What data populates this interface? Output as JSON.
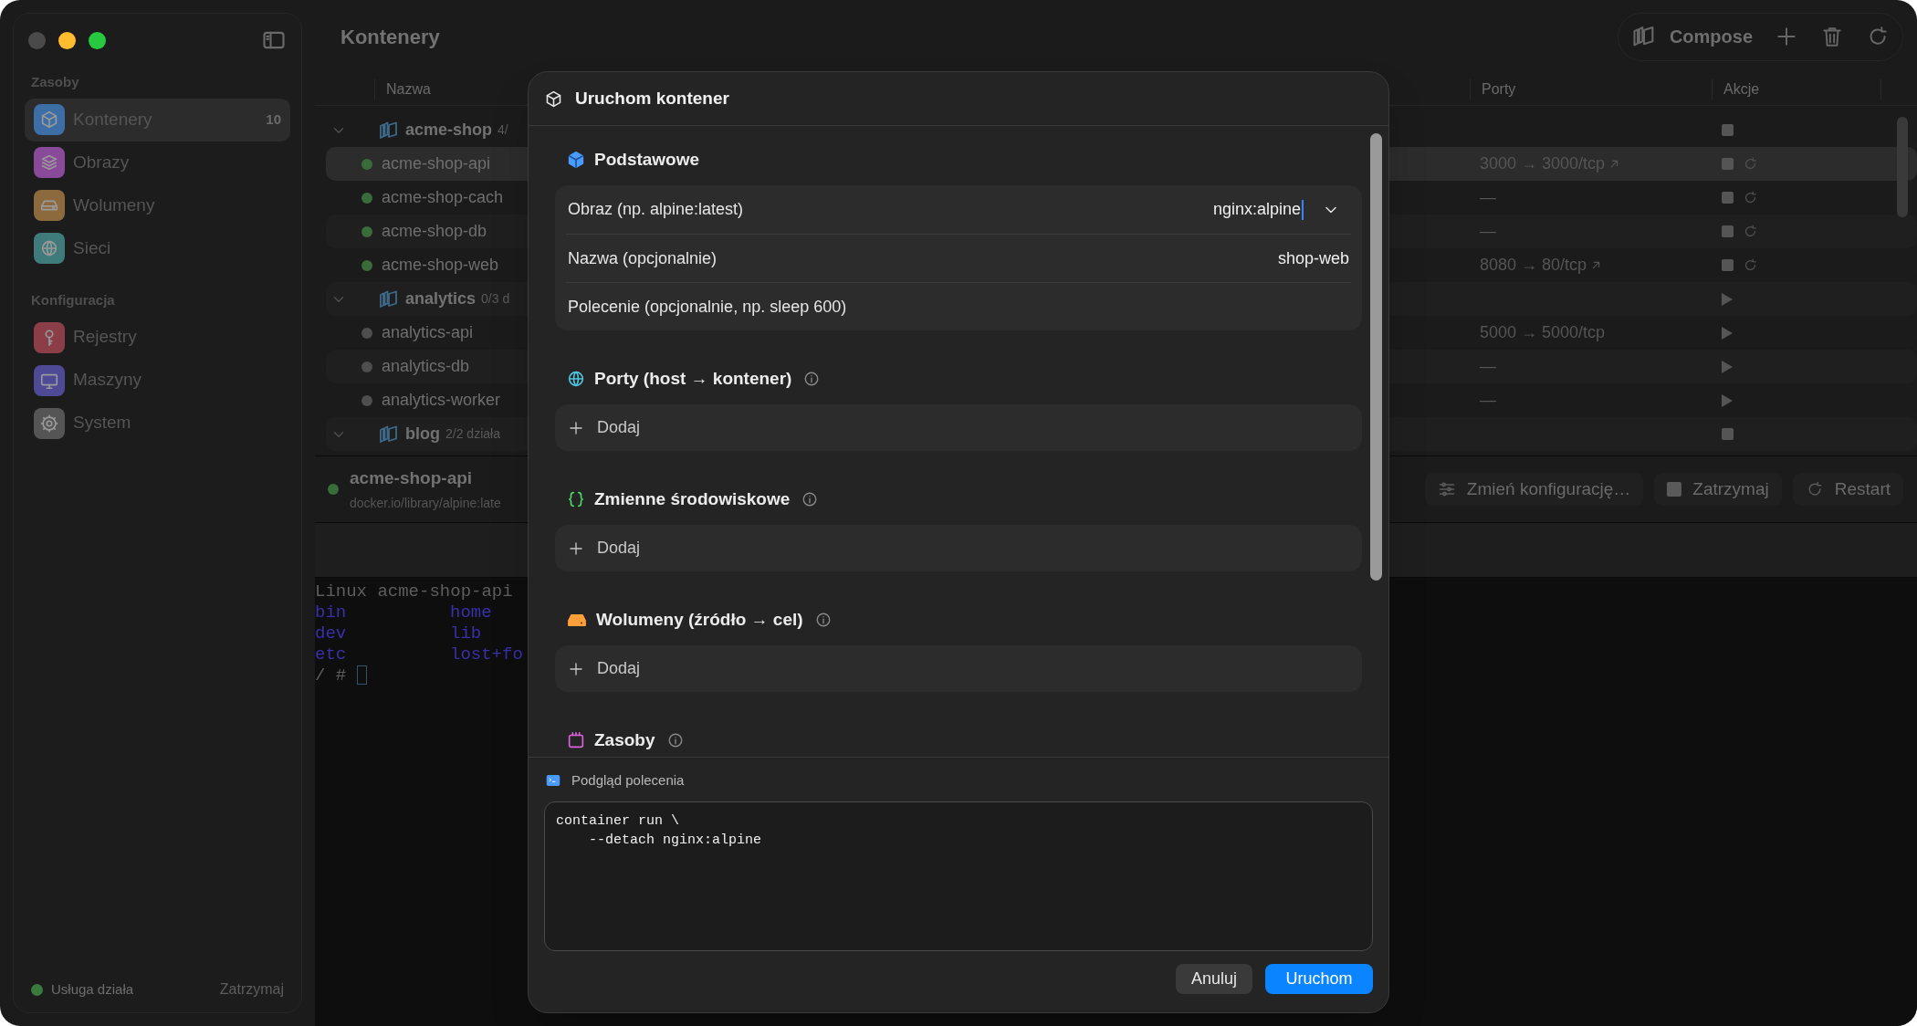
{
  "sidebar": {
    "sections": [
      {
        "title": "Zasoby",
        "items": [
          {
            "label": "Kontenery",
            "count": "10",
            "selected": true,
            "color": "#3d6ea5"
          },
          {
            "label": "Obrazy",
            "selected": false,
            "color": "#8a4a9a"
          },
          {
            "label": "Wolumeny",
            "selected": false,
            "color": "#8c6a3e"
          },
          {
            "label": "Sieci",
            "selected": false,
            "color": "#3e7b7a"
          }
        ]
      },
      {
        "title": "Konfiguracja",
        "items": [
          {
            "label": "Rejestry",
            "selected": false,
            "color": "#8c3e48"
          },
          {
            "label": "Maszyny",
            "selected": false,
            "color": "#4e4a96"
          },
          {
            "label": "System",
            "selected": false,
            "color": "#555555"
          }
        ]
      }
    ],
    "status": {
      "text": "Usługa działa",
      "running": true,
      "action": "Zatrzymaj"
    }
  },
  "title": "Kontenery",
  "toolbar": {
    "compose_label": "Compose"
  },
  "table": {
    "columns": [
      "Nazwa",
      "Porty",
      "Akcje"
    ],
    "rows": [
      {
        "kind": "group",
        "name": "acme-shop",
        "count": "4/",
        "expanded": true,
        "running": true,
        "selected": false
      },
      {
        "kind": "container",
        "name": "acme-shop-api",
        "ports": "3000 → 3000/tcp",
        "link": true,
        "running": true,
        "selected": true
      },
      {
        "kind": "container",
        "name": "acme-shop-cach",
        "ports": "—",
        "link": false,
        "running": true,
        "selected": false
      },
      {
        "kind": "container",
        "name": "acme-shop-db",
        "ports": "—",
        "link": false,
        "running": true,
        "selected": false
      },
      {
        "kind": "container",
        "name": "acme-shop-web",
        "ports": "8080 → 80/tcp",
        "link": true,
        "running": true,
        "selected": false
      },
      {
        "kind": "group",
        "name": "analytics",
        "count": "0/3 d",
        "expanded": true,
        "running": false,
        "selected": false
      },
      {
        "kind": "container",
        "name": "analytics-api",
        "ports": "5000 → 5000/tcp",
        "link": false,
        "running": false,
        "selected": false
      },
      {
        "kind": "container",
        "name": "analytics-db",
        "ports": "—",
        "link": false,
        "running": false,
        "selected": false
      },
      {
        "kind": "container",
        "name": "analytics-worker",
        "ports": "—",
        "link": false,
        "running": false,
        "selected": false
      },
      {
        "kind": "group",
        "name": "blog",
        "count": "2/2 działa",
        "expanded": true,
        "running": true,
        "selected": false
      }
    ]
  },
  "details": {
    "name": "acme-shop-api",
    "image": "docker.io/library/alpine:late",
    "running": true,
    "buttons": [
      "Zmień konfigurację…",
      "Zatrzymaj",
      "Restart"
    ]
  },
  "terminal": {
    "lines": [
      {
        "kind": "text",
        "text": "Linux acme-shop-api"
      },
      {
        "kind": "listing",
        "entries": [
          "bin",
          "home"
        ]
      },
      {
        "kind": "listing",
        "entries": [
          "dev",
          "lib"
        ]
      },
      {
        "kind": "listing",
        "entries": [
          "etc",
          "lost+fo"
        ]
      },
      {
        "kind": "prompt",
        "text": "/ #"
      }
    ]
  },
  "modal": {
    "title": "Uruchom kontener",
    "sections": [
      {
        "title": "Podstawowe",
        "info": false,
        "fields": [
          {
            "label": "Obraz (np. alpine:latest)",
            "value": "nginx:alpine",
            "focused": true,
            "dropdown": true
          },
          {
            "label": "Nazwa (opcjonalnie)",
            "value": "shop-web",
            "focused": false,
            "dropdown": false
          },
          {
            "label": "Polecenie (opcjonalnie, np. sleep 600)",
            "focused": false,
            "dropdown": false
          }
        ]
      },
      {
        "title": "Porty (host → kontener)",
        "info": true,
        "add_label": "Dodaj"
      },
      {
        "title": "Zmienne środowiskowe",
        "info": true,
        "add_label": "Dodaj"
      },
      {
        "title": "Wolumeny (źródło → cel)",
        "info": true,
        "add_label": "Dodaj"
      },
      {
        "title": "Zasoby",
        "info": true
      }
    ],
    "preview": {
      "title": "Podgląd polecenia",
      "code": "container run \\\n    --detach nginx:alpine"
    },
    "buttons": [
      {
        "label": "Anuluj",
        "primary": false
      },
      {
        "label": "Uruchom",
        "primary": true
      }
    ]
  }
}
